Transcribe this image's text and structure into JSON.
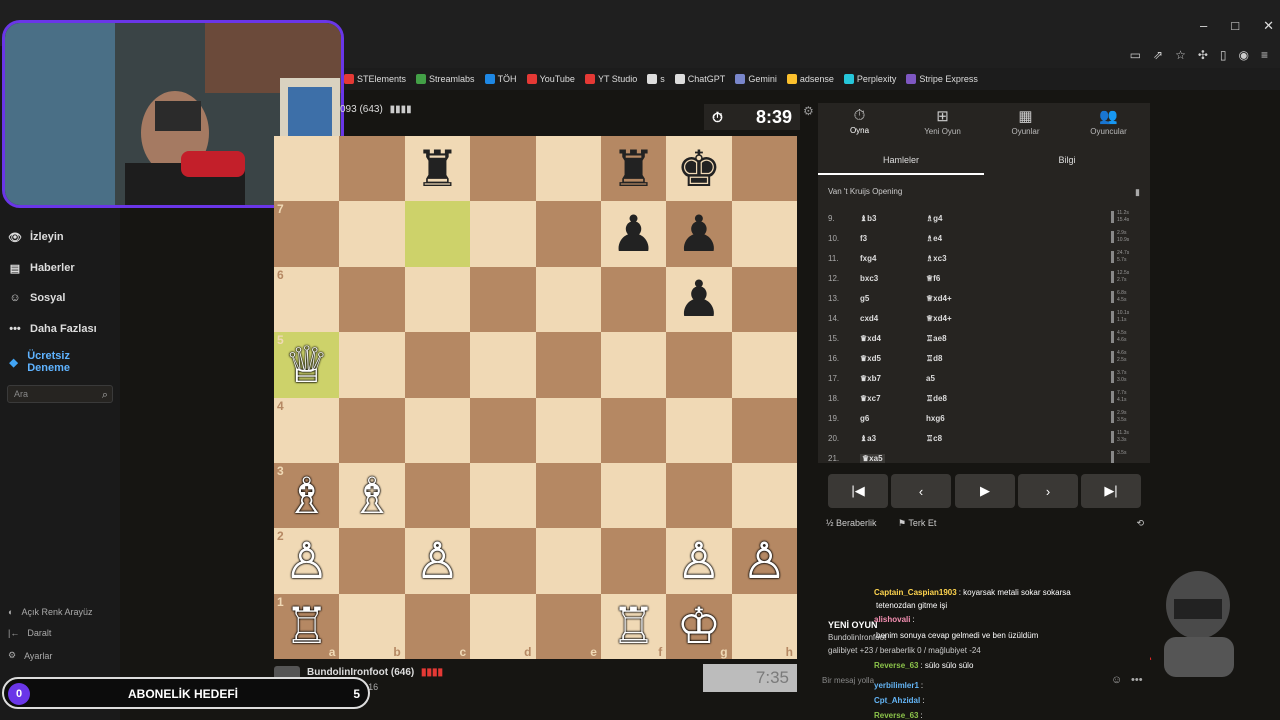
{
  "browser": {
    "bookmarks": [
      "STElements",
      "Streamlabs",
      "TÖH",
      "YouTube",
      "YT Studio",
      "s",
      "ChatGPT",
      "Gemini",
      "adsense",
      "Perplexity",
      "Stripe Express"
    ]
  },
  "sidebar": {
    "items": [
      {
        "label": "İzleyin",
        "icon": "binoculars-icon"
      },
      {
        "label": "Haberler",
        "icon": "news-icon"
      },
      {
        "label": "Sosyal",
        "icon": "people-icon"
      },
      {
        "label": "Daha Fazlası",
        "icon": "more-dots-icon"
      },
      {
        "label": "Ücretsiz Deneme",
        "icon": "diamond-icon"
      }
    ],
    "search_placeholder": "Ara",
    "bottom": [
      {
        "label": "Açık Renk Arayüz",
        "icon": "contrast-icon"
      },
      {
        "label": "Daralt",
        "icon": "collapse-icon"
      },
      {
        "label": "Ayarlar",
        "icon": "gear-icon"
      }
    ]
  },
  "game": {
    "top_player": "093 (643)",
    "top_clock": "8:39",
    "bottom_player": "BundolinIronfoot (646)",
    "bottom_material": "+16",
    "bottom_clock": "7:35"
  },
  "panel": {
    "tabs": [
      {
        "label": "Oyna",
        "icon": "stopwatch-icon"
      },
      {
        "label": "Yeni Oyun",
        "icon": "plus-icon"
      },
      {
        "label": "Oyunlar",
        "icon": "board-icon"
      },
      {
        "label": "Oyuncular",
        "icon": "players-icon"
      }
    ],
    "subtabs": [
      "Hamleler",
      "Bilgi"
    ],
    "opening": "Van 't Kruijs Opening",
    "moves": [
      {
        "n": "9.",
        "w": "♝b3",
        "b": "♗g4",
        "t1": "11.2s",
        "t2": "15.4s"
      },
      {
        "n": "10.",
        "w": "f3",
        "b": "♗e4",
        "t1": "2.9s",
        "t2": "10.9s"
      },
      {
        "n": "11.",
        "w": "fxg4",
        "b": "♗xc3",
        "t1": "24.7s",
        "t2": "5.7s"
      },
      {
        "n": "12.",
        "w": "bxc3",
        "b": "♕f6",
        "t1": "12.5s",
        "t2": "2.7s"
      },
      {
        "n": "13.",
        "w": "g5",
        "b": "♕xd4+",
        "t1": "6.8s",
        "t2": "4.5s"
      },
      {
        "n": "14.",
        "w": "cxd4",
        "b": "♕xd4+",
        "t1": "10.1s",
        "t2": "1.1s"
      },
      {
        "n": "15.",
        "w": "♛xd4",
        "b": "♖ae8",
        "t1": "4.5s",
        "t2": "4.6s"
      },
      {
        "n": "16.",
        "w": "♛xd5",
        "b": "♖d8",
        "t1": "4.6s",
        "t2": "2.5s"
      },
      {
        "n": "17.",
        "w": "♛xb7",
        "b": "a5",
        "t1": "3.7s",
        "t2": "3.0s"
      },
      {
        "n": "18.",
        "w": "♛xc7",
        "b": "♖de8",
        "t1": "7.7s",
        "t2": "4.1s"
      },
      {
        "n": "19.",
        "w": "g6",
        "b": "hxg6",
        "t1": "2.9s",
        "t2": "3.5s"
      },
      {
        "n": "20.",
        "w": "♝a3",
        "b": "♖c8",
        "t1": "11.3s",
        "t2": "3.3s"
      },
      {
        "n": "21.",
        "w": "♛xa5",
        "b": "",
        "t1": "3.5s",
        "t2": ""
      }
    ],
    "draw": "Beraberlik",
    "resign": "Terk Et"
  },
  "chat": {
    "lines": [
      {
        "user": "Captain_Caspian1903",
        "text": ": koyarsak metali sokar sokarsa"
      },
      {
        "user": "",
        "text": "tetenozdan gitme işi"
      },
      {
        "user": "alishovali",
        "text": ":"
      },
      {
        "user": "",
        "text": "benim sonuya cevap gelmedi ve ben üzüldüm"
      },
      {
        "user": "Reverse_63",
        "text": ": sülo sülo sülo"
      },
      {
        "user": "yerbilimler1",
        "text": ":"
      },
      {
        "user": "Cpt_Ahzidal",
        "text": ":"
      },
      {
        "user": "Reverse_63",
        "text": ":"
      }
    ],
    "overlay_title": "YENİ OYUN",
    "overlay_sub": "BundolinIronfoot",
    "overlay_stats": "galibiyet +23 / beraberlik 0 / mağlubiyet -24",
    "placeholder": "Bir mesaj yolla"
  },
  "overlay": {
    "goal_count": "0",
    "goal_label": "ABONELİK HEDEFİ",
    "goal_target": "5"
  },
  "board": {
    "pieces": [
      {
        "sq": "c8",
        "g": "♜",
        "c": "b"
      },
      {
        "sq": "f8",
        "g": "♜",
        "c": "b"
      },
      {
        "sq": "g8",
        "g": "♚",
        "c": "b"
      },
      {
        "sq": "f7",
        "g": "♟",
        "c": "b"
      },
      {
        "sq": "g7",
        "g": "♟",
        "c": "b"
      },
      {
        "sq": "g6",
        "g": "♟",
        "c": "b"
      },
      {
        "sq": "a5",
        "g": "♕",
        "c": "w"
      },
      {
        "sq": "a3",
        "g": "♗",
        "c": "w"
      },
      {
        "sq": "b3",
        "g": "♗",
        "c": "w"
      },
      {
        "sq": "a2",
        "g": "♙",
        "c": "w"
      },
      {
        "sq": "c2",
        "g": "♙",
        "c": "w"
      },
      {
        "sq": "g2",
        "g": "♙",
        "c": "w"
      },
      {
        "sq": "h2",
        "g": "♙",
        "c": "w"
      },
      {
        "sq": "a1",
        "g": "♖",
        "c": "w"
      },
      {
        "sq": "f1",
        "g": "♖",
        "c": "w"
      },
      {
        "sq": "g1",
        "g": "♔",
        "c": "w"
      }
    ],
    "highlights": [
      "c7",
      "a5"
    ],
    "ranks": [
      "7",
      "6",
      "5",
      "4",
      "3",
      "2",
      "1"
    ],
    "files": [
      "a",
      "b",
      "c",
      "d",
      "e",
      "f",
      "g",
      "h"
    ]
  }
}
